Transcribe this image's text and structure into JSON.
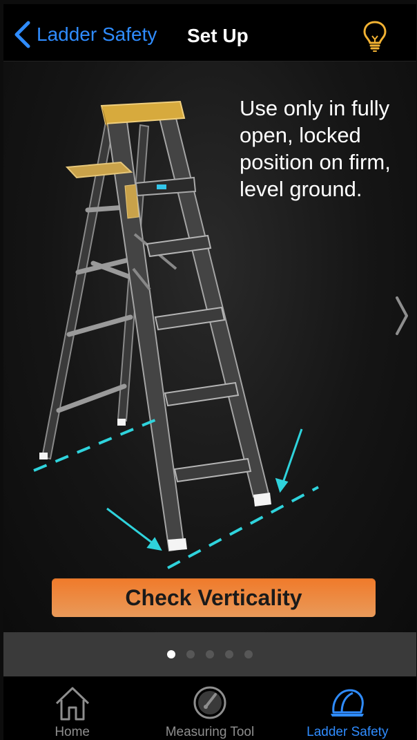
{
  "nav": {
    "back_label": "Ladder Safety",
    "title": "Set Up",
    "hint_icon": "lightbulb-icon",
    "accent_color": "#2f8cff",
    "hint_color": "#f2b233"
  },
  "slide": {
    "instruction": "Use only in fully open, locked position on firm, level ground.",
    "cta_label": "Check Verticality",
    "cta_color": "#f07a2a",
    "guide_color": "#2fd3dc"
  },
  "pager": {
    "total": 5,
    "current": 1
  },
  "tabbar": {
    "items": [
      {
        "label": "Home",
        "icon": "house-icon",
        "selected": false
      },
      {
        "label": "Measuring Tool",
        "icon": "gauge-icon",
        "selected": false
      },
      {
        "label": "Ladder Safety",
        "icon": "hard-hat-icon",
        "selected": true
      }
    ]
  }
}
